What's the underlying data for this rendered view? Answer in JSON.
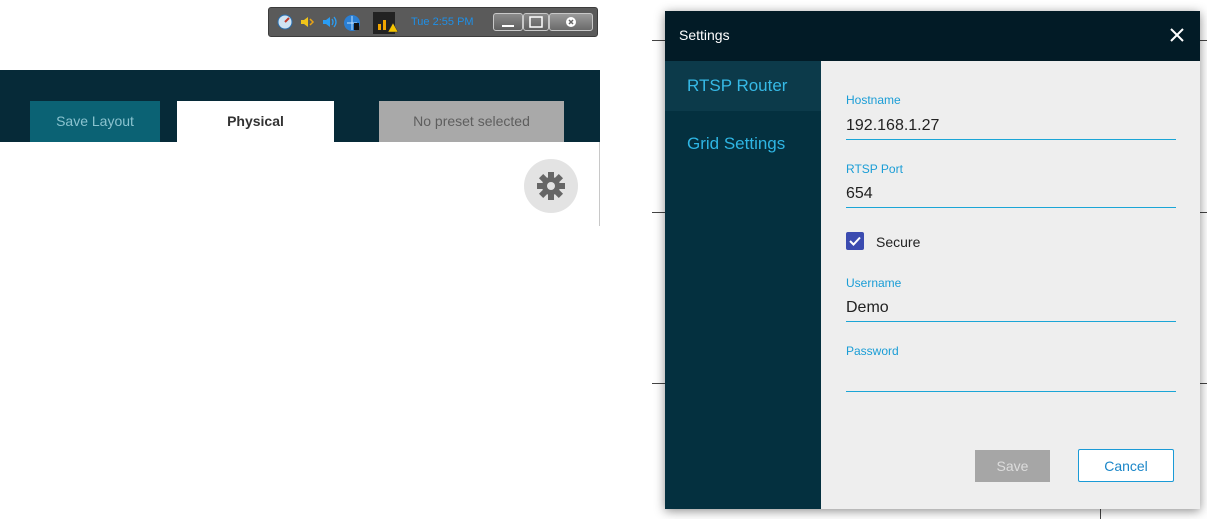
{
  "tray": {
    "time": "Tue 2:55 PM",
    "icons": [
      "speedometer-icon",
      "volume-icon",
      "speaker-icon",
      "network-icon",
      "signal-warning-icon"
    ]
  },
  "app": {
    "save_layout_label": "Save Layout",
    "tab_label": "Physical",
    "preset_label": "No preset selected"
  },
  "dialog": {
    "title": "Settings",
    "nav": [
      {
        "label": "RTSP Router",
        "active": true
      },
      {
        "label": "Grid Settings",
        "active": false
      }
    ],
    "fields": {
      "hostname": {
        "label": "Hostname",
        "value": "192.168.1.27"
      },
      "rtsp_port": {
        "label": "RTSP Port",
        "value": "654"
      },
      "secure": {
        "label": "Secure",
        "checked": true
      },
      "username": {
        "label": "Username",
        "value": "Demo"
      },
      "password": {
        "label": "Password",
        "value": ""
      }
    },
    "save_label": "Save",
    "cancel_label": "Cancel"
  },
  "colors": {
    "header_dark": "#062a38",
    "dialog_header": "#021b26",
    "nav_bg": "#04303f",
    "accent": "#1a9dd6",
    "checkbox": "#3b4bb0"
  }
}
